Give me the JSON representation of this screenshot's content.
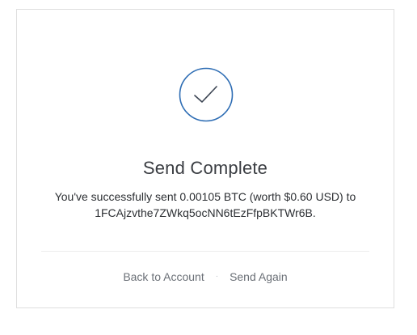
{
  "theme": {
    "accent": "#2e6db4",
    "border": "#dedede"
  },
  "confirmation": {
    "icon": "checkmark-icon",
    "title": "Send Complete",
    "message_line1": "You've successfully sent 0.00105 BTC (worth $0.60 USD) to",
    "message_line2": "1FCAjzvthe7ZWkq5ocNN6tEzFfpBKTWr6B."
  },
  "actions": {
    "back_label": "Back to Account",
    "separator": "·",
    "send_again_label": "Send Again"
  }
}
